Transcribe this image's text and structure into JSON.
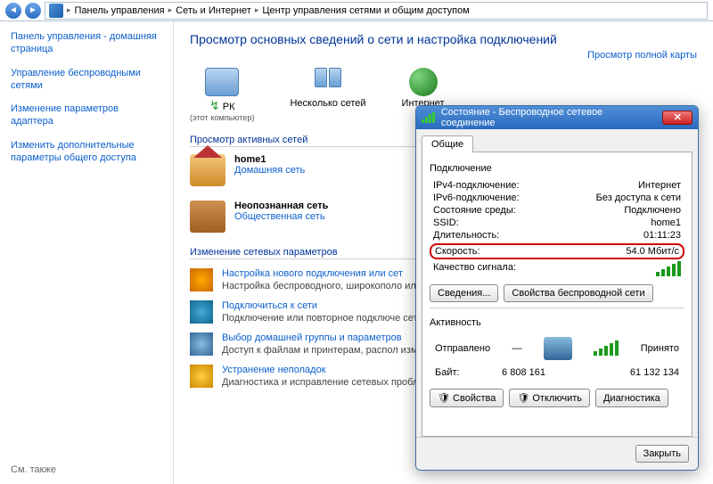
{
  "breadcrumb": {
    "seg1": "Панель управления",
    "seg2": "Сеть и Интернет",
    "seg3": "Центр управления сетями и общим доступом"
  },
  "sidebar": {
    "home": "Панель управления - домашняя страница",
    "wifi": "Управление беспроводными сетями",
    "adapter": "Изменение параметров адаптера",
    "sharing": "Изменить дополнительные параметры общего доступа",
    "see_also": "См. также"
  },
  "content": {
    "title": "Просмотр основных сведений о сети и настройка подключений",
    "full_map": "Просмотр полной карты",
    "node_pc": "РК",
    "node_pc_sub": "(этот компьютер)",
    "node_multi": "Несколько сетей",
    "node_inet": "Интернет",
    "active_hdr": "Просмотр активных сетей",
    "net1_name": "home1",
    "net1_type": "Домашняя сеть",
    "net2_name": "Неопознанная сеть",
    "net2_type": "Общественная сеть",
    "params_hdr": "Изменение сетевых параметров",
    "t1_link": "Настройка нового подключения или сет",
    "t1_desc": "Настройка беспроводного, широкополо или же настройка маршрутизатора или",
    "t2_link": "Подключиться к сети",
    "t2_desc": "Подключение или повторное подключе сетевому соединению или подключени",
    "t3_link": "Выбор домашней группы и параметров",
    "t3_desc": "Доступ к файлам и принтерам, распол изменение параметров общего доступа",
    "t4_link": "Устранение неполадок",
    "t4_desc": "Диагностика и исправление сетевых проблем или получение сведений об исправлении."
  },
  "dialog": {
    "title": "Состояние - Беспроводное сетевое соединение",
    "tab_general": "Общие",
    "grp_conn": "Подключение",
    "ipv4_l": "IPv4-подключение:",
    "ipv4_v": "Интернет",
    "ipv6_l": "IPv6-подключение:",
    "ipv6_v": "Без доступа к сети",
    "media_l": "Состояние среды:",
    "media_v": "Подключено",
    "ssid_l": "SSID:",
    "ssid_v": "home1",
    "dur_l": "Длительность:",
    "dur_v": "01:11:23",
    "speed_l": "Скорость:",
    "speed_v": "54.0 Мбит/с",
    "quality_l": "Качество сигнала:",
    "btn_details": "Сведения...",
    "btn_wprops": "Свойства беспроводной сети",
    "grp_act": "Активность",
    "sent": "Отправлено",
    "recv": "Принято",
    "bytes_l": "Байт:",
    "bytes_sent": "6 808 161",
    "bytes_recv": "61 132 134",
    "btn_props": "Свойства",
    "btn_disable": "Отключить",
    "btn_diag": "Диагностика",
    "btn_close": "Закрыть"
  }
}
